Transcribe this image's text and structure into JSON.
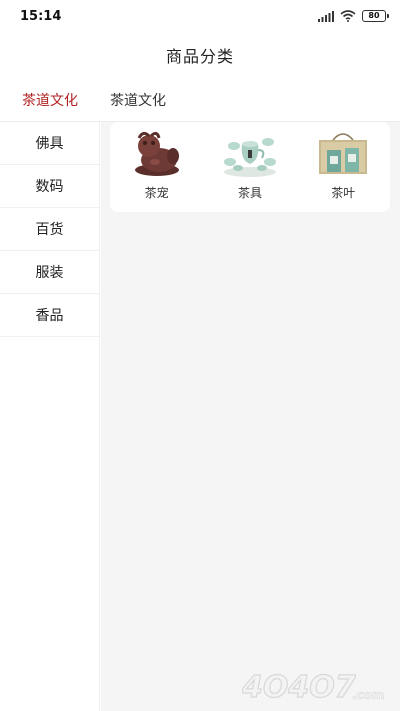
{
  "status": {
    "time": "15:14",
    "battery": "80"
  },
  "header": {
    "title": "商品分类"
  },
  "top_category": {
    "selected": "茶道文化",
    "heading": "茶道文化"
  },
  "sidebar": {
    "items": [
      {
        "label": "佛具"
      },
      {
        "label": "数码"
      },
      {
        "label": "百货"
      },
      {
        "label": "服装"
      },
      {
        "label": "香品"
      }
    ]
  },
  "products": [
    {
      "label": "茶宠",
      "icon": "tea-pet-image"
    },
    {
      "label": "茶具",
      "icon": "tea-set-image"
    },
    {
      "label": "茶叶",
      "icon": "tea-leaves-image"
    }
  ],
  "watermark": {
    "text": "4O4O7.com"
  },
  "colors": {
    "accent": "#b22222",
    "background": "#f5f5f5"
  }
}
